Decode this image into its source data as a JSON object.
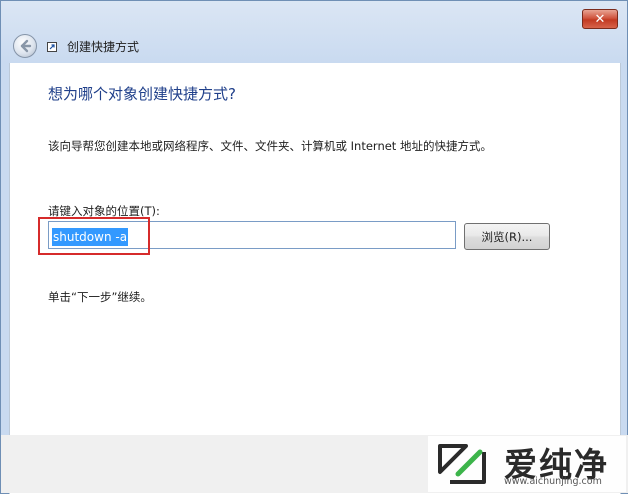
{
  "window": {
    "title": "创建快捷方式",
    "close_label": "✕"
  },
  "wizard": {
    "heading": "想为哪个对象创建快捷方式?",
    "description": "该向导帮您创建本地或网络程序、文件、文件夹、计算机或 Internet 地址的快捷方式。",
    "location_label": "请键入对象的位置(T):",
    "location_value": "shutdown -a",
    "browse_label": "浏览(R)...",
    "instruction": "单击“下一步”继续。"
  },
  "watermark": {
    "text": "爱纯净",
    "url": "www.aichunjing.com"
  },
  "colors": {
    "heading": "#1f3f8a",
    "selection": "#3399ff",
    "highlight": "#d62b2b"
  },
  "icons": [
    "close-icon",
    "back-arrow-icon",
    "shortcut-icon",
    "watermark-logo-icon"
  ]
}
